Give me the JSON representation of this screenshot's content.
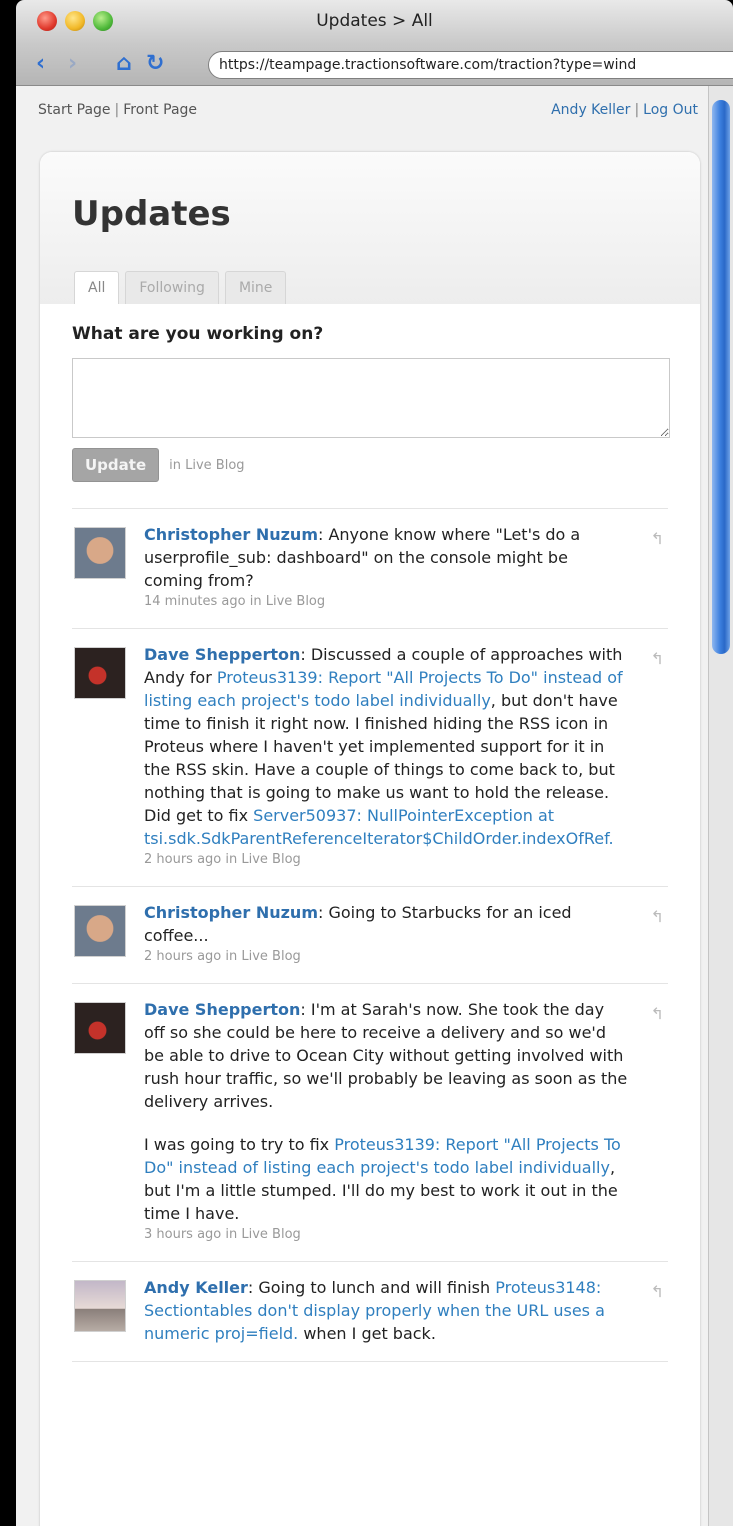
{
  "window": {
    "title": "Updates > All"
  },
  "browser": {
    "url": "https://teampage.tractionsoftware.com/traction?type=wind"
  },
  "topnav": {
    "start_page": "Start Page",
    "front_page": "Front Page",
    "user": "Andy Keller",
    "logout": "Log Out",
    "separator": "|"
  },
  "page": {
    "title": "Updates",
    "tabs": [
      "All",
      "Following",
      "Mine"
    ],
    "active_tab": "All"
  },
  "compose": {
    "label": "What are you working on?",
    "value": "",
    "button": "Update",
    "destination": "in Live Blog"
  },
  "feed": [
    {
      "author": "Christopher Nuzum",
      "text": ": Anyone know where \"Let's do a userprofile_sub: dashboard\" on the console might be coming from?",
      "meta": "14 minutes ago in Live Blog"
    },
    {
      "author": "Dave Shepperton",
      "text_a": ": Discussed a couple of approaches with Andy for ",
      "link_a": "Proteus3139: Report \"All Projects To Do\" instead of listing each project's todo label individually",
      "text_b": ", but don't have time to finish it right now. I finished hiding the RSS icon in Proteus where I haven't yet implemented support for it in the RSS skin. Have a couple of things to come back to, but nothing that is going to make us want to hold the release. Did get to fix ",
      "link_b": "Server50937: NullPointerException at tsi.sdk.SdkParentReferenceIterator$ChildOrder.indexOfRef.",
      "meta": "2 hours ago in Live Blog"
    },
    {
      "author": "Christopher Nuzum",
      "text": ": Going to Starbucks for an iced coffee...",
      "meta": "2 hours ago in Live Blog"
    },
    {
      "author": "Dave Shepperton",
      "text": ": I'm at Sarah's now. She took the day off so she could be here to receive a delivery and so we'd be able to drive to Ocean City without getting involved with rush hour traffic, so we'll probably be leaving as soon as the delivery arrives.",
      "para2_a": "I was going to try to fix ",
      "para2_link": "Proteus3139: Report \"All Projects To Do\" instead of listing each project's todo label individually",
      "para2_b": ", but I'm a little stumped. I'll do my best to work it out in the time I have.",
      "meta": "3 hours ago in Live Blog"
    },
    {
      "author": "Andy Keller",
      "text_a": ": Going to lunch and will finish ",
      "link_a": "Proteus3148: Sectiontables don't display properly when the URL uses a numeric proj=field.",
      "text_b": " when I get back."
    }
  ],
  "icons": {
    "reply": "reply-arrow-icon"
  }
}
